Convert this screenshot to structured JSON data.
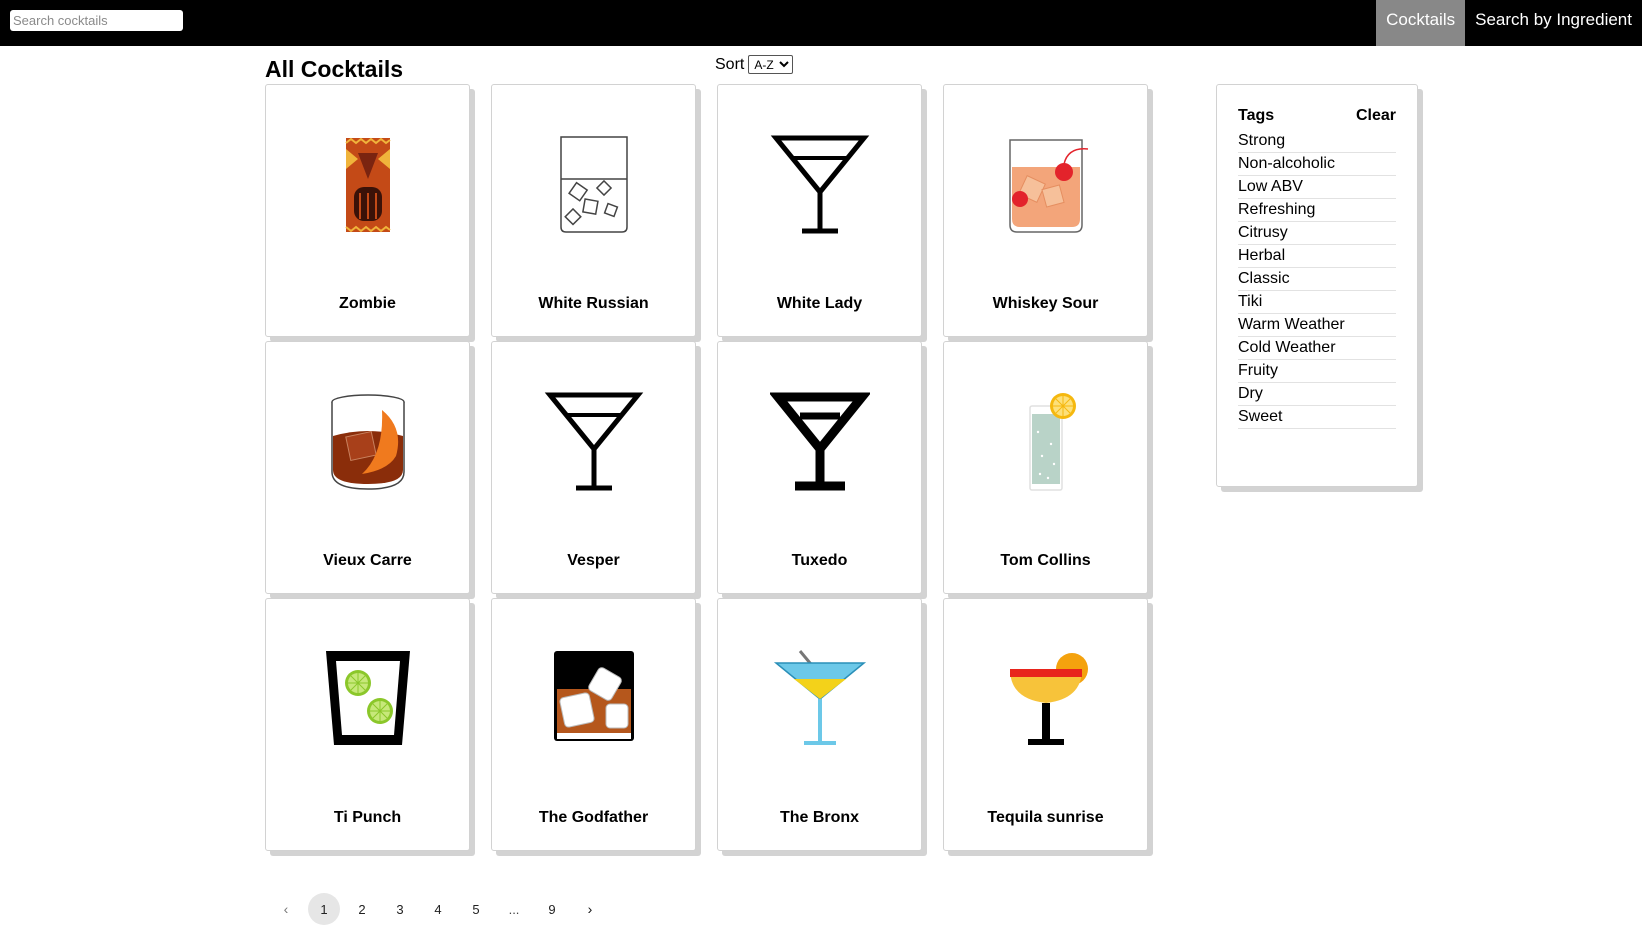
{
  "search": {
    "placeholder": "Search cocktails",
    "value": ""
  },
  "nav": {
    "items": [
      {
        "label": "Cocktails",
        "active": true
      },
      {
        "label": "Search by Ingredient",
        "active": false
      }
    ]
  },
  "main": {
    "title": "All Cocktails",
    "sort": {
      "label": "Sort",
      "selected": "A-Z",
      "options": [
        "A-Z"
      ]
    }
  },
  "cocktails": [
    {
      "name": "Zombie",
      "icon": "tiki-mug-icon"
    },
    {
      "name": "White Russian",
      "icon": "rocks-glass-ice-icon"
    },
    {
      "name": "White Lady",
      "icon": "martini-glass-outline-icon"
    },
    {
      "name": "Whiskey Sour",
      "icon": "rocks-glass-cherry-icon"
    },
    {
      "name": "Vieux Carre",
      "icon": "rocks-glass-orange-peel-icon"
    },
    {
      "name": "Vesper",
      "icon": "martini-glass-outline-icon"
    },
    {
      "name": "Tuxedo",
      "icon": "martini-glass-bold-icon"
    },
    {
      "name": "Tom Collins",
      "icon": "collins-glass-lemon-icon"
    },
    {
      "name": "Ti Punch",
      "icon": "rocks-glass-lime-icon"
    },
    {
      "name": "The Godfather",
      "icon": "rocks-glass-whiskey-ice-icon"
    },
    {
      "name": "The Bronx",
      "icon": "cocktail-glass-straw-icon"
    },
    {
      "name": "Tequila sunrise",
      "icon": "sunrise-glass-icon"
    }
  ],
  "pagination": {
    "prev_icon": "chevron-left-icon",
    "next_icon": "chevron-right-icon",
    "pages": [
      "1",
      "2",
      "3",
      "4",
      "5",
      "...",
      "9"
    ],
    "current": "1"
  },
  "tags": {
    "title": "Tags",
    "clear_label": "Clear",
    "items": [
      "Strong",
      "Non-alcoholic",
      "Low ABV",
      "Refreshing",
      "Citrusy",
      "Herbal",
      "Classic",
      "Tiki",
      "Warm Weather",
      "Cold Weather",
      "Fruity",
      "Dry",
      "Sweet"
    ]
  }
}
